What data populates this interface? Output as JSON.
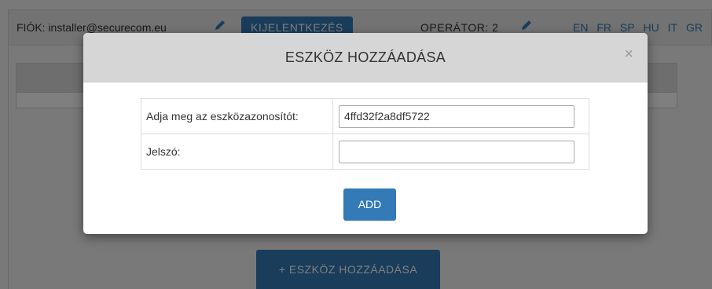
{
  "header": {
    "account_text": "FIÓK: installer@securecom.eu",
    "logout_label": "KIJELENTKEZÉS",
    "operator_text": "OPERÁTOR: 2",
    "languages": [
      "EN",
      "FR",
      "SP",
      "HU",
      "IT",
      "GR"
    ]
  },
  "page": {
    "add_device_button": "+ ESZKÖZ HOZZÁADÁSA"
  },
  "modal": {
    "title": "ESZKÖZ HOZZÁADÁSA",
    "close_symbol": "×",
    "fields": [
      {
        "label": "Adja meg az eszközazonosítót:",
        "value": "4ffd32f2a8df5722"
      },
      {
        "label": "Jelszó:",
        "value": ""
      }
    ],
    "submit_label": "ADD"
  },
  "colors": {
    "primary": "#337ab7",
    "header_bg": "#d6d6d6"
  }
}
